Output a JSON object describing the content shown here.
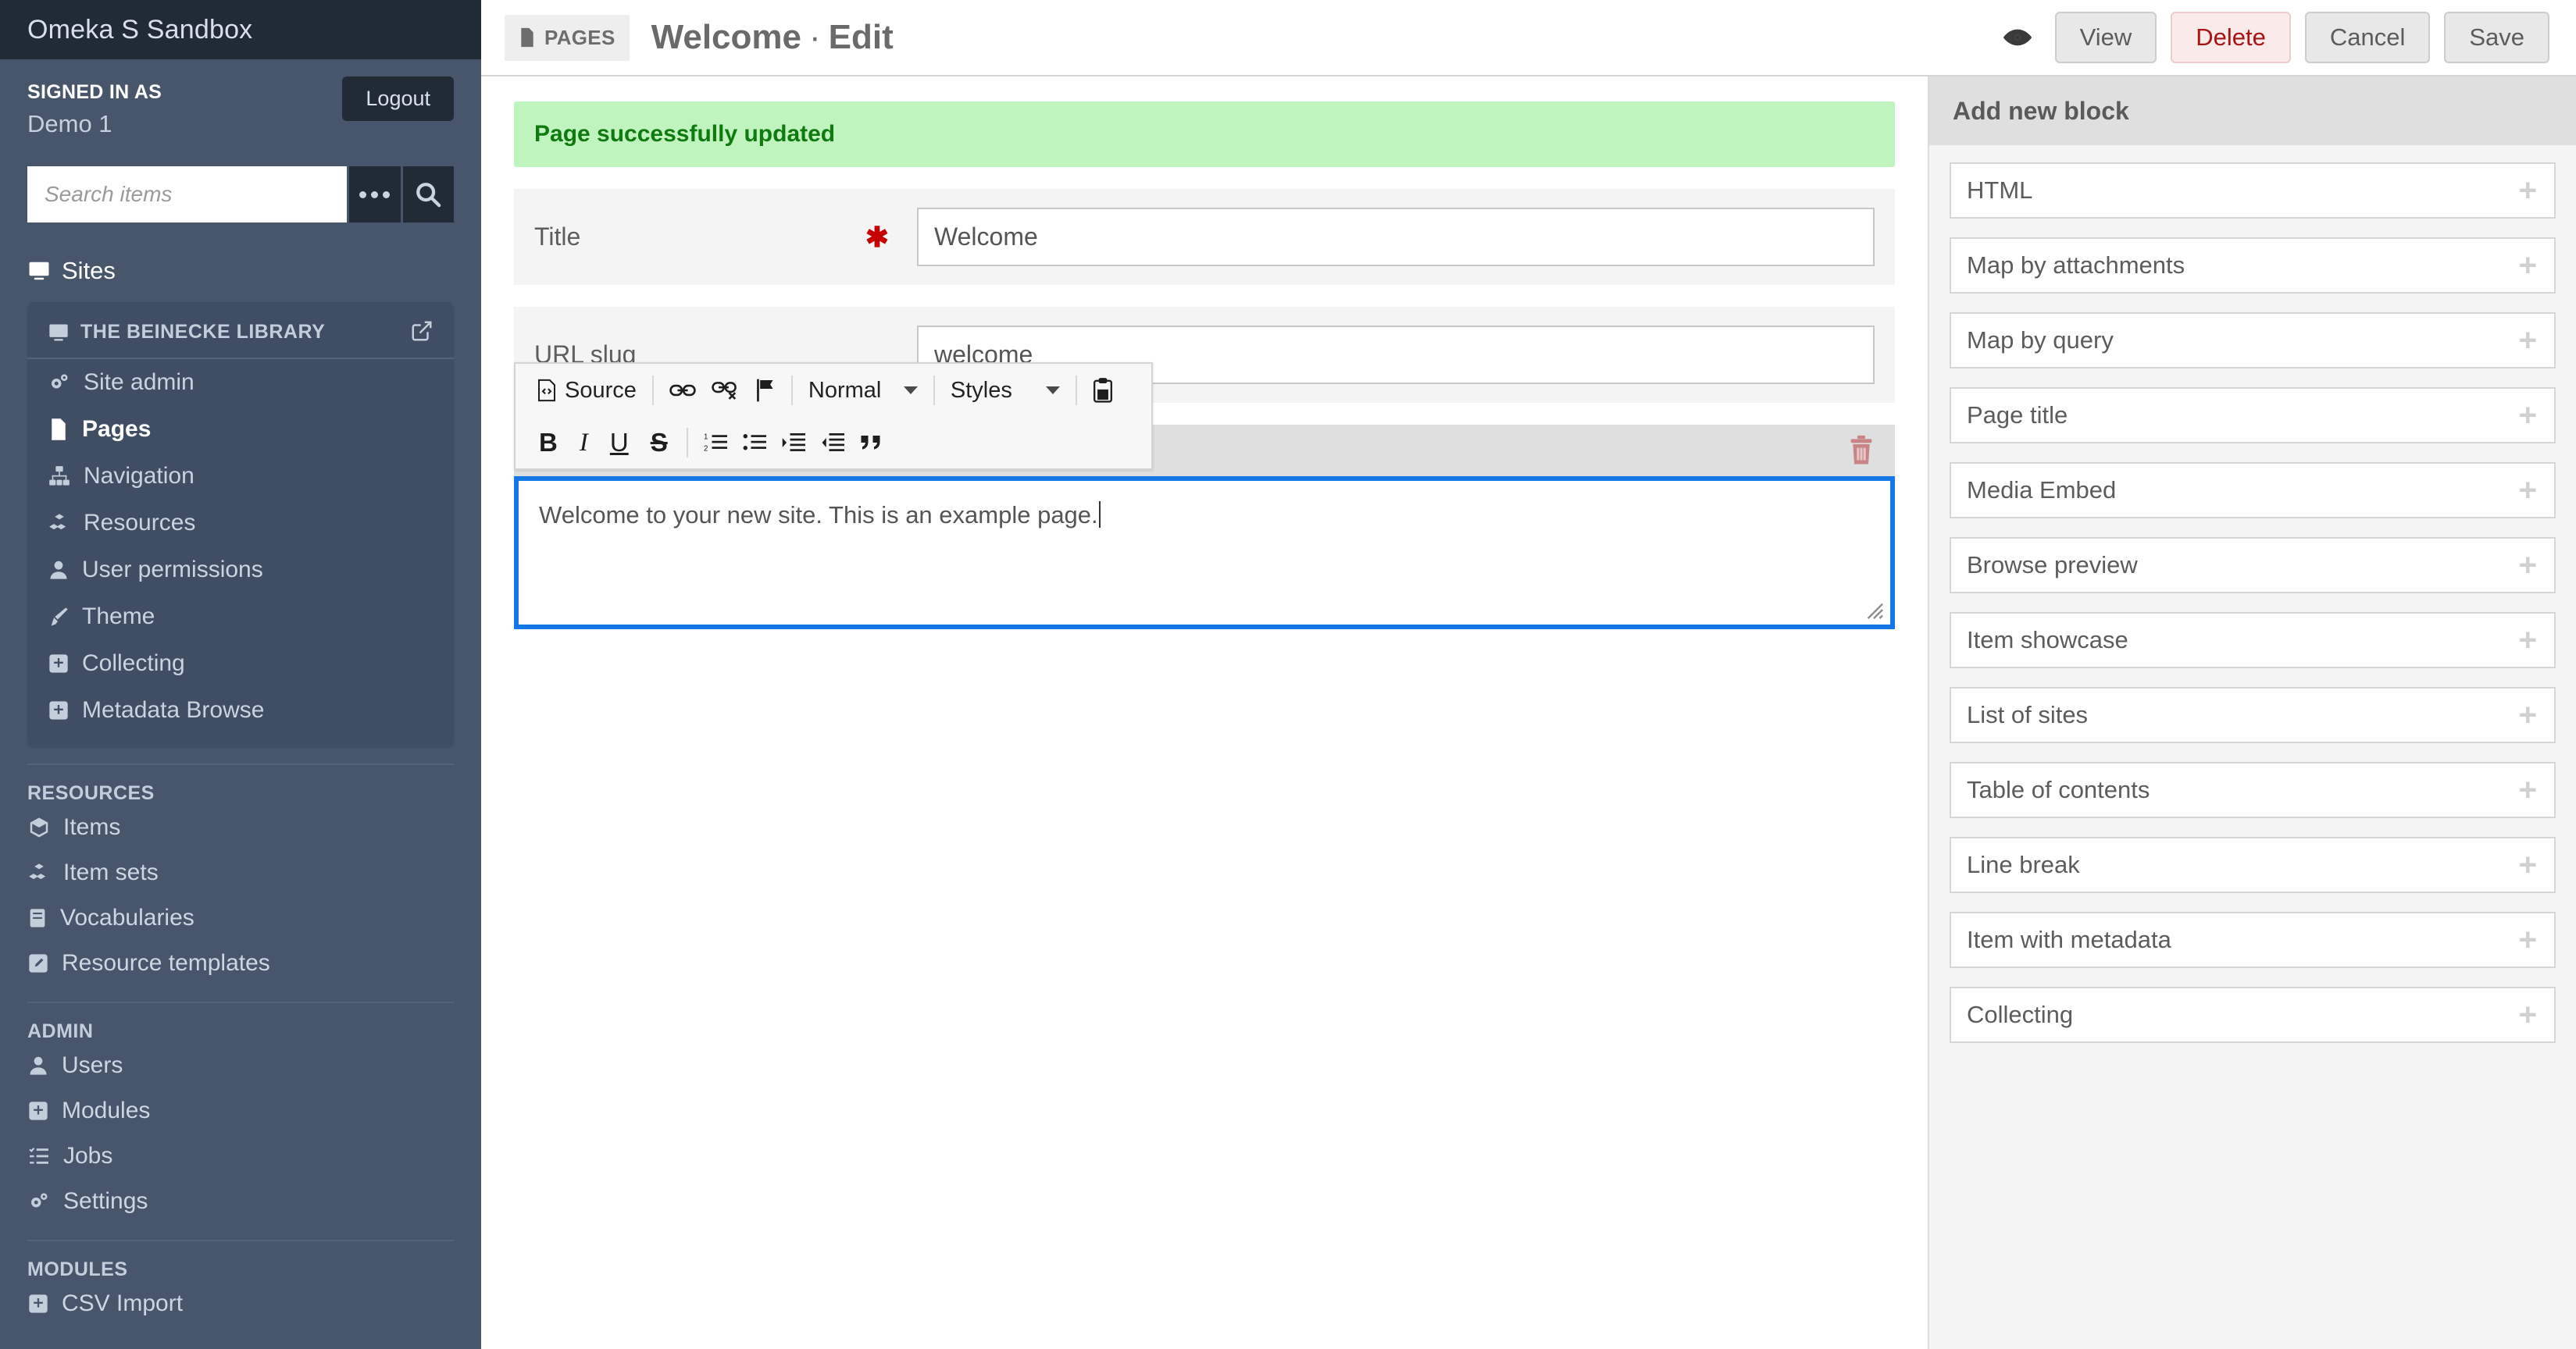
{
  "sidebar": {
    "brand_title": "Omeka S Sandbox",
    "signed_in_label": "SIGNED IN AS",
    "user_name": "Demo 1",
    "logout_label": "Logout",
    "search_placeholder": "Search items",
    "sites_label": "Sites",
    "site_card": {
      "title": "THE BEINECKE LIBRARY",
      "items": [
        {
          "label": "Site admin",
          "icon": "gears-icon",
          "active": false
        },
        {
          "label": "Pages",
          "icon": "page-icon",
          "active": true
        },
        {
          "label": "Navigation",
          "icon": "sitemap-icon",
          "active": false
        },
        {
          "label": "Resources",
          "icon": "cubes-icon",
          "active": false
        },
        {
          "label": "User permissions",
          "icon": "user-icon",
          "active": false
        },
        {
          "label": "Theme",
          "icon": "brush-icon",
          "active": false
        },
        {
          "label": "Collecting",
          "icon": "puzzle-icon",
          "active": false
        },
        {
          "label": "Metadata Browse",
          "icon": "puzzle-icon",
          "active": false
        }
      ]
    },
    "groups": [
      {
        "label": "RESOURCES",
        "items": [
          {
            "label": "Items",
            "icon": "cube-icon"
          },
          {
            "label": "Item sets",
            "icon": "cubes-icon"
          },
          {
            "label": "Vocabularies",
            "icon": "book-icon"
          },
          {
            "label": "Resource templates",
            "icon": "pencil-square-icon"
          }
        ]
      },
      {
        "label": "ADMIN",
        "items": [
          {
            "label": "Users",
            "icon": "user-icon"
          },
          {
            "label": "Modules",
            "icon": "puzzle-icon"
          },
          {
            "label": "Jobs",
            "icon": "tasks-icon"
          },
          {
            "label": "Settings",
            "icon": "gears-icon"
          }
        ]
      },
      {
        "label": "MODULES",
        "items": [
          {
            "label": "CSV Import",
            "icon": "puzzle-icon"
          }
        ]
      }
    ]
  },
  "topbar": {
    "breadcrumb_chip": "PAGES",
    "page_name": "Welcome",
    "separator": "·",
    "page_mode": "Edit",
    "preview_icon": "eye-icon",
    "buttons": [
      {
        "label": "View",
        "name": "view-button",
        "style": "default"
      },
      {
        "label": "Delete",
        "name": "delete-button",
        "style": "danger"
      },
      {
        "label": "Cancel",
        "name": "cancel-button",
        "style": "default"
      },
      {
        "label": "Save",
        "name": "save-button",
        "style": "default"
      }
    ]
  },
  "main": {
    "flash_message": "Page successfully updated",
    "fields": [
      {
        "label": "Title",
        "required": true,
        "value": "Welcome"
      },
      {
        "label": "URL slug",
        "required": false,
        "value": "welcome"
      }
    ],
    "block": {
      "delete_icon": "trash-icon",
      "content": "Welcome to your new site. This is an example page."
    }
  },
  "editor_toolbar": {
    "source_label": "Source",
    "format_value": "Normal",
    "styles_value": "Styles",
    "row1_icons": [
      "source-icon",
      "link-icon",
      "unlink-icon",
      "anchor-flag-icon",
      "paste-from-word-icon"
    ],
    "row2_icons": [
      "bold-icon",
      "italic-icon",
      "underline-icon",
      "strikethrough-icon",
      "numbered-list-icon",
      "bulleted-list-icon",
      "increase-indent-icon",
      "decrease-indent-icon",
      "blockquote-icon"
    ],
    "bold_label": "B",
    "italic_label": "I",
    "underline_label": "U",
    "strike_label": "S"
  },
  "right_panel": {
    "heading": "Add new block",
    "add_icon": "plus-icon",
    "blocks": [
      "HTML",
      "Map by attachments",
      "Map by query",
      "Page title",
      "Media Embed",
      "Browse preview",
      "Item showcase",
      "List of sites",
      "Table of contents",
      "Line break",
      "Item with metadata",
      "Collecting"
    ]
  },
  "colors": {
    "sidebar_bg": "#47566b",
    "sidebar_dark": "#212b36",
    "flash_bg": "#bff4bf",
    "flash_text": "#0f7a0f",
    "focus_blue": "#1477e6",
    "danger_red": "#a81414",
    "trash_red": "#c98585"
  }
}
